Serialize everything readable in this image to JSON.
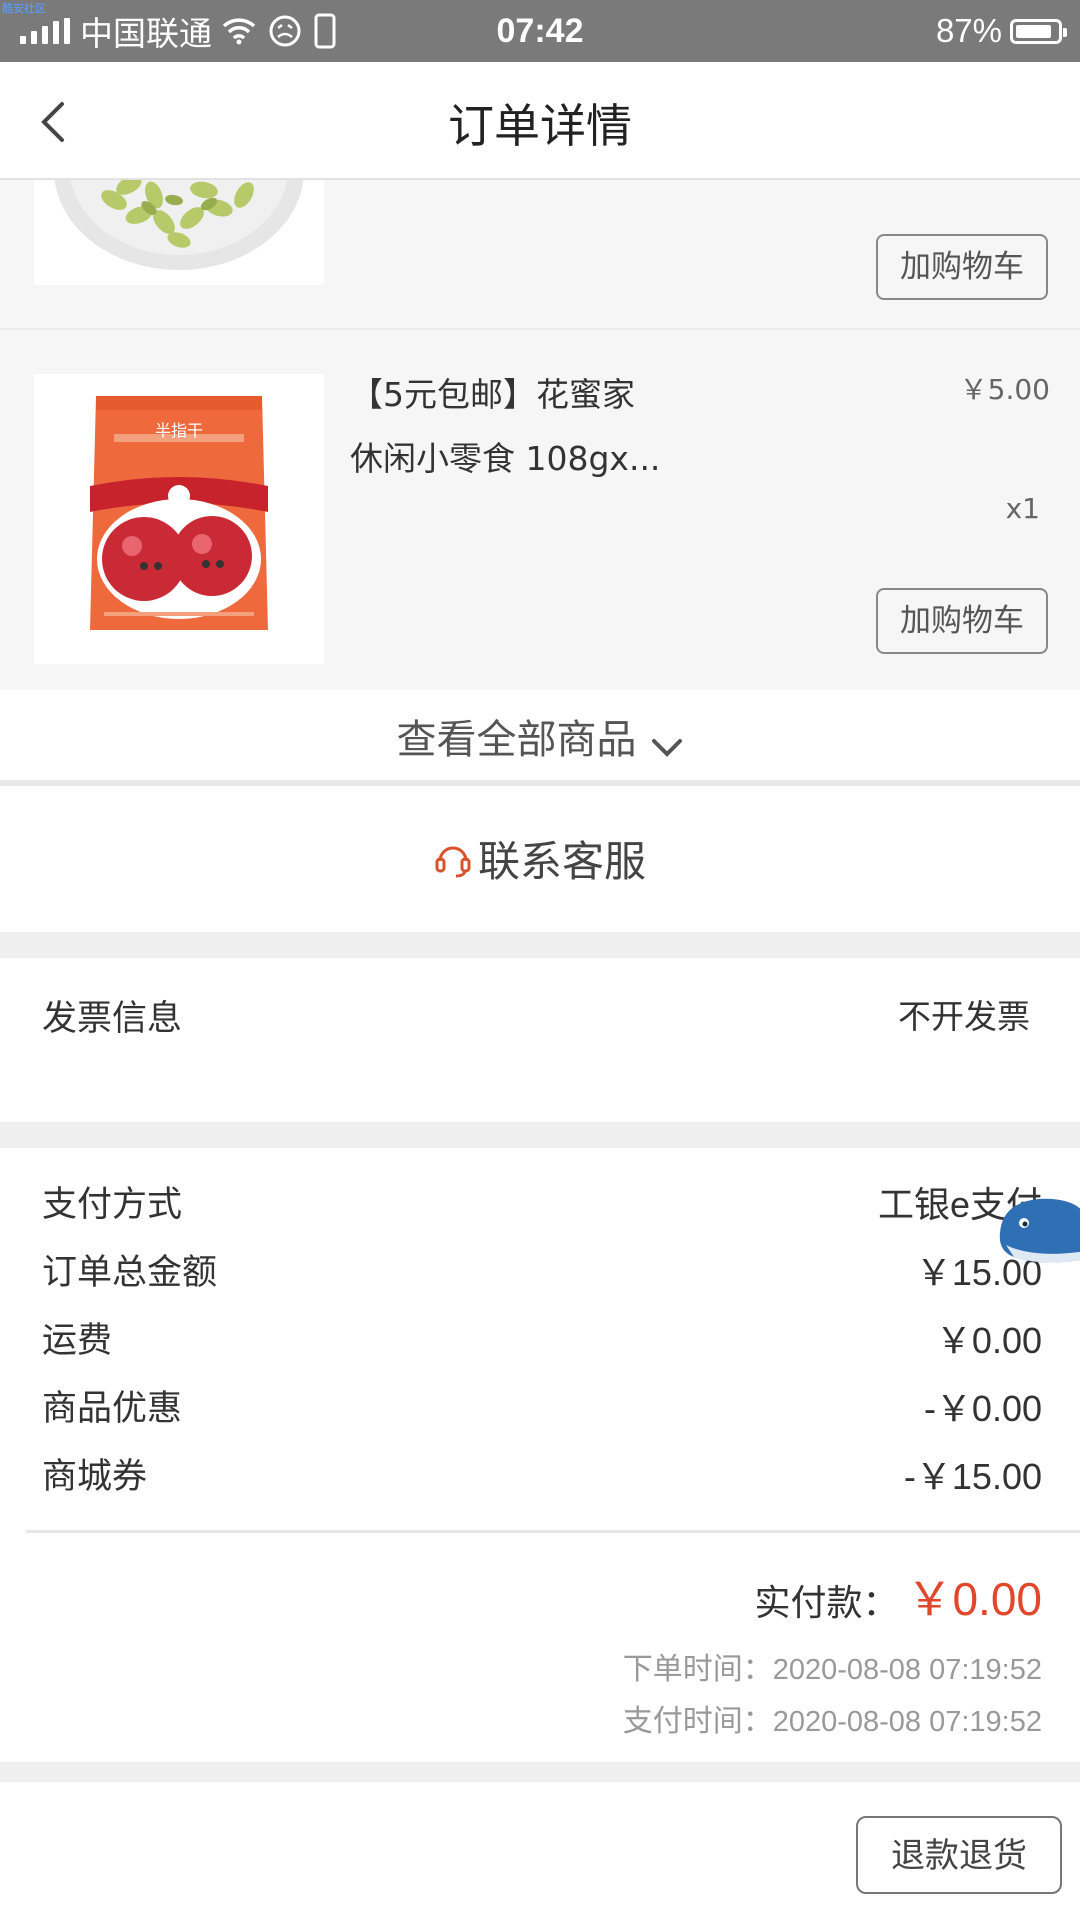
{
  "status_bar": {
    "watermark": "酷安社区",
    "carrier": "中国联通",
    "time": "07:42",
    "battery": "87%",
    "battery_level": 0.87
  },
  "header": {
    "title": "订单详情",
    "back_icon": "chevron-left-icon"
  },
  "products": [
    {
      "image": "green-raisins-plate",
      "cart_label": "加购物车"
    },
    {
      "image": "dried-apple-bag",
      "name_line1": "【5元包邮】花蜜家",
      "name_line2": "休闲小零食 108gx...",
      "price": "￥5.00",
      "qty": "x1",
      "cart_label": "加购物车",
      "package_text": "半指干"
    }
  ],
  "view_all": {
    "label": "查看全部商品",
    "icon": "chevron-down-icon"
  },
  "contact": {
    "label": "联系客服",
    "icon": "headset-icon",
    "icon_color": "#d9532c"
  },
  "invoice": {
    "label": "发票信息",
    "value": "不开发票"
  },
  "payment": {
    "rows": [
      {
        "label": "支付方式",
        "value": "工银e支付"
      },
      {
        "label": "订单总金额",
        "value": "￥15.00"
      },
      {
        "label": "运费",
        "value": "￥0.00"
      },
      {
        "label": "商品优惠",
        "value": "-￥0.00"
      },
      {
        "label": "商城券",
        "value": "-￥15.00"
      }
    ],
    "actual_label": "实付款：",
    "actual_amount": "￥0.00",
    "accent": "#e0472b",
    "order_time_label": "下单时间：",
    "order_time": "2020-08-08 07:19:52",
    "pay_time_label": "支付时间：",
    "pay_time": "2020-08-08 07:19:52"
  },
  "bottom": {
    "refund_label": "退款退货"
  },
  "floating": {
    "icon": "whale-icon"
  }
}
